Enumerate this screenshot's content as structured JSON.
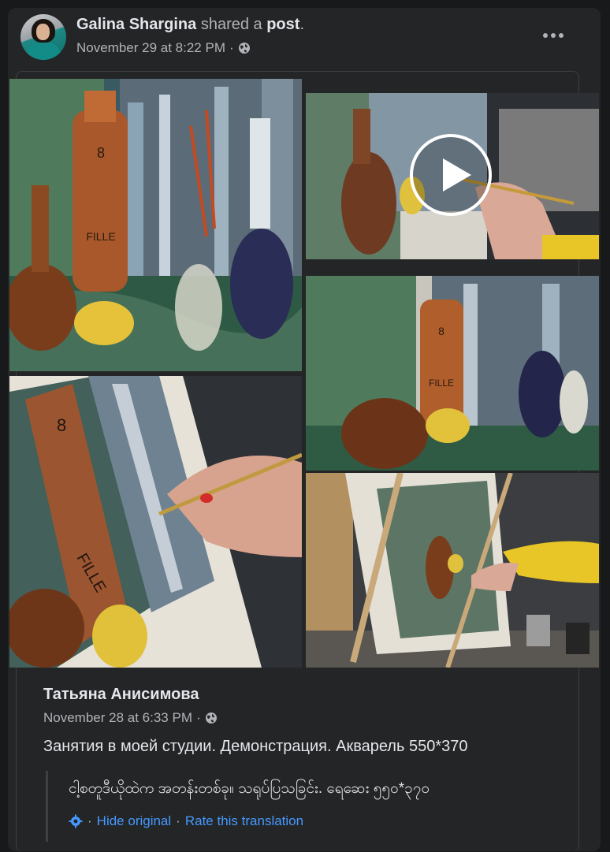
{
  "post": {
    "author": "Galina Shargina",
    "action_text": " shared a ",
    "object": "post",
    "object_suffix": ".",
    "timestamp": "November 29 at 8:22 PM",
    "separator": "·",
    "audience_icon": "globe-icon",
    "more_icon": "more-options-icon"
  },
  "gallery": {
    "video_icon": "play-icon",
    "images": [
      "still life painting: bottles and lemon",
      "video: painting in progress",
      "still life painting: bottles on canvas",
      "close-up of brush on painting",
      "easel with painting in studio"
    ]
  },
  "original": {
    "author": "Татьяна Анисимова",
    "timestamp": "November 28 at 6:33 PM",
    "separator": "·",
    "audience_icon": "globe-icon",
    "text": "Занятия в моей студии. Демонстрация. Акварель 550*370"
  },
  "translation": {
    "text": "ငါ့စတူဒီယိုထဲက အတန်းတစ်ခု။ သရုပ်ပြသခြင်း. ရေဆေး ၅၅၀*၃၇၀",
    "settings_icon": "gear-icon",
    "sep": "·",
    "hide_label": "Hide original",
    "rate_label": "Rate this translation"
  },
  "colors": {
    "background": "#18191a",
    "card": "#242526",
    "text_primary": "#e4e6eb",
    "text_secondary": "#b0b3b8",
    "link": "#4599ff"
  }
}
